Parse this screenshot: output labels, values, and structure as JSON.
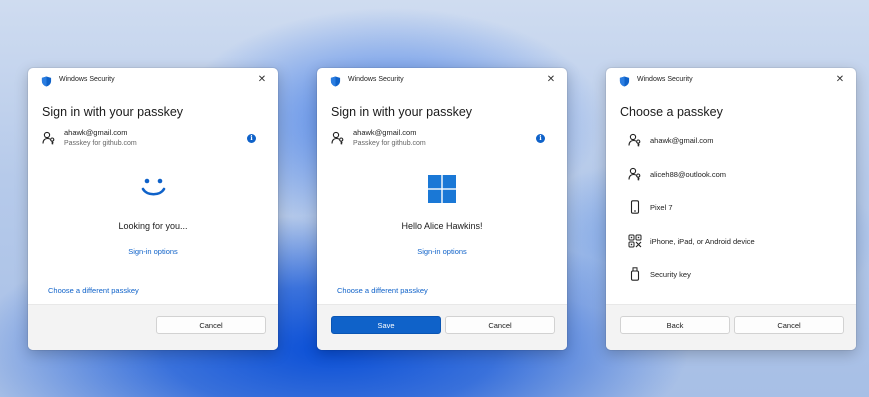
{
  "colors": {
    "accent": "#0f62c9",
    "shield": "#0f62c9"
  },
  "dialogs": [
    {
      "title": "Windows Security",
      "heading": "Sign in with your passkey",
      "account": {
        "email": "ahawk@gmail.com",
        "subtitle": "Passkey for github.com"
      },
      "status": "Looking for you...",
      "signin_options": "Sign-in options",
      "different_passkey": "Choose a different passkey",
      "cancel_label": "Cancel"
    },
    {
      "title": "Windows Security",
      "heading": "Sign in with your passkey",
      "account": {
        "email": "ahawk@gmail.com",
        "subtitle": "Passkey for github.com"
      },
      "status": "Hello Alice Hawkins!",
      "signin_options": "Sign-in options",
      "different_passkey": "Choose a different passkey",
      "save_label": "Save",
      "cancel_label": "Cancel"
    },
    {
      "title": "Windows Security",
      "heading": "Choose a passkey",
      "passkeys": [
        {
          "icon": "passkey-icon",
          "label": "ahawk@gmail.com"
        },
        {
          "icon": "passkey-icon",
          "label": "aliceh88@outlook.com"
        },
        {
          "icon": "phone-icon",
          "label": "Pixel 7"
        },
        {
          "icon": "qr-code-icon",
          "label": "iPhone, iPad, or Android device"
        },
        {
          "icon": "security-key-icon",
          "label": "Security key"
        }
      ],
      "back_label": "Back",
      "cancel_label": "Cancel"
    }
  ]
}
